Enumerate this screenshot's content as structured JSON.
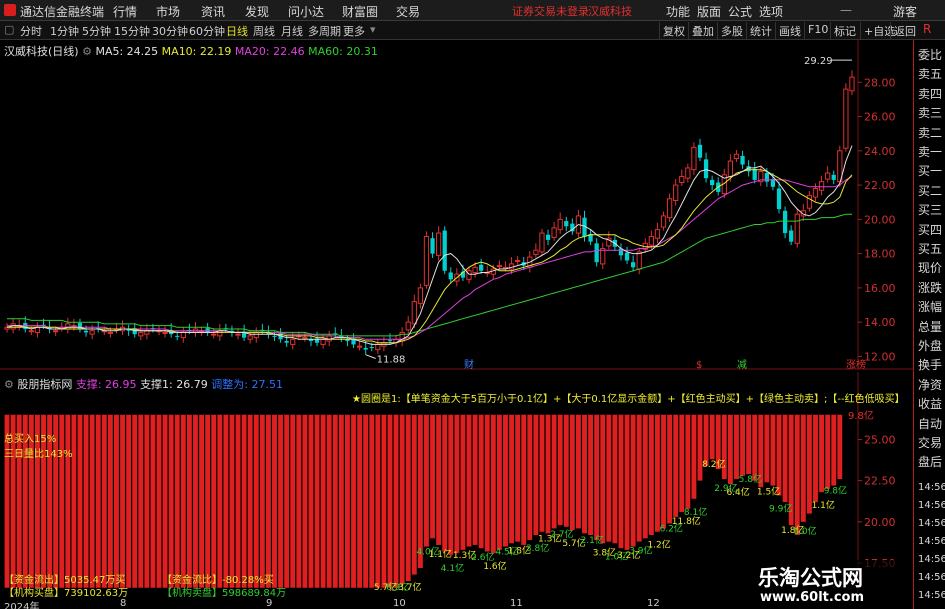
{
  "app": {
    "title": "通达信金融终端",
    "menu": [
      "行情",
      "市场",
      "资讯",
      "发现",
      "问小达",
      "财富圈",
      "交易"
    ],
    "notice": "证券交易未登录",
    "stock_title": "汉威科技",
    "right_menu": [
      "功能",
      "版面",
      "公式",
      "选项"
    ],
    "user": "游客"
  },
  "toolbar": {
    "periods": [
      "分时",
      "1分钟",
      "5分钟",
      "15分钟",
      "30分钟",
      "60分钟",
      "日线",
      "周线",
      "月线",
      "多周期",
      "更多"
    ],
    "selected_period": "日线",
    "buttons": [
      "复权",
      "叠加",
      "多股",
      "统计",
      "画线",
      "F10",
      "标记",
      "+自选",
      "返回"
    ]
  },
  "side_panel": {
    "corner": "R",
    "items": [
      "委比",
      "卖五",
      "卖四",
      "卖三",
      "卖二",
      "卖一",
      "买一",
      "买二",
      "买三",
      "买四",
      "买五",
      "现价",
      "涨跌",
      "涨幅",
      "总量",
      "外盘",
      "换手",
      "净资",
      "收益",
      "自动",
      "交易",
      "盘后"
    ],
    "time_labels": [
      "14:56",
      "14:56",
      "14:56",
      "14:56",
      "14:56",
      "14:56",
      "14:56"
    ]
  },
  "price_chart": {
    "name_label": "汉威科技(日线)",
    "ma": [
      {
        "label": "MA5: 24.25",
        "color": "#e0e0e0"
      },
      {
        "label": "MA10: 22.19",
        "color": "#e8e830"
      },
      {
        "label": "MA20: 22.46",
        "color": "#e040e0"
      },
      {
        "label": "MA60: 20.31",
        "color": "#30d030"
      }
    ],
    "high_label": "29.29",
    "low_label": "11.88",
    "event_marks": [
      {
        "text": "财",
        "color": "#3a7aff"
      },
      {
        "text": "$",
        "color": "#e03030"
      },
      {
        "text": "减",
        "color": "#30d030"
      },
      {
        "text": "涨榜",
        "color": "#e03030"
      }
    ]
  },
  "indicator": {
    "name": "股朋指标网",
    "support_a": "支撑: 26.95",
    "support_b": "支撑1: 26.79",
    "support_c": "调整为: 27.51",
    "legend": "★圆圈是1:【单笔资金大于5百万小于0.1亿】+【大于0.1亿显示金额】+【红色主动买】+【绿色主动卖】;【--红色低吸买】",
    "total_buy": "总买入15%",
    "ratio_3day": "三日量比143%",
    "fund_flow": "【资金流出】5035.47万买",
    "fund_ratio": "【资金流比】-80.28%买",
    "inst_buy": "【机构买盘】739102.63万",
    "inst_sell": "【机构卖盘】598689.84万",
    "top_value": "9.8亿",
    "small_labels": [
      "5.7亿",
      "6.9亿",
      "3.7亿",
      "4.0亿",
      "1.1亿",
      "4.1亿",
      "1.3亿",
      "2.6亿",
      "1.6亿",
      "4.5亿",
      "1.8亿",
      "3.8亿",
      "1.3亿",
      "2.7亿",
      "5.7亿",
      "2.1亿",
      "3.8亿",
      "1.0亿",
      "3.2亿",
      "3.9亿",
      "1.2亿",
      "6.2亿",
      "11.8亿",
      "8.1亿",
      "8.2亿",
      "2.9亿",
      "6.4亿",
      "5.8亿",
      "1.5亿",
      "9.9亿",
      "1.8亿",
      "6.0亿",
      "1.1亿",
      "9.8亿"
    ]
  },
  "axes": {
    "price_ticks": [
      "28.00",
      "26.00",
      "24.00",
      "22.00",
      "20.00",
      "18.00",
      "16.00",
      "14.00",
      "12.00"
    ],
    "ind_ticks": [
      "25.00",
      "22.50",
      "20.00",
      "17.50"
    ],
    "x_ticks": [
      "2024年",
      "8",
      "9",
      "10",
      "11",
      "12"
    ]
  },
  "watermark": {
    "title": "乐淘公式网",
    "url": "www.60lt.com"
  },
  "colors": {
    "up": "#e03030",
    "down": "#00d0d0",
    "ma5": "#e0e0e0",
    "ma10": "#e8e830",
    "ma20": "#e040e0",
    "ma60": "#30d030",
    "indicator_bar": "#e02020"
  },
  "chart_data": {
    "type": "candlestick",
    "y_range": [
      11.5,
      30
    ],
    "closes": [
      13.7,
      13.9,
      13.8,
      13.6,
      13.5,
      13.7,
      13.8,
      13.6,
      13.5,
      13.7,
      13.9,
      13.8,
      13.6,
      13.4,
      13.5,
      13.6,
      13.5,
      13.4,
      13.6,
      13.7,
      13.5,
      13.3,
      13.4,
      13.5,
      13.6,
      13.5,
      13.4,
      13.3,
      13.2,
      13.4,
      13.5,
      13.6,
      13.5,
      13.4,
      13.3,
      13.5,
      13.6,
      13.4,
      13.3,
      13.1,
      13.2,
      13.4,
      13.5,
      13.3,
      13.2,
      13.0,
      12.8,
      13.0,
      13.2,
      13.1,
      12.9,
      12.8,
      13.0,
      13.2,
      13.3,
      13.1,
      12.9,
      12.7,
      12.6,
      12.4,
      12.5,
      12.7,
      12.8,
      12.9,
      13.0,
      13.4,
      14.0,
      15.2,
      16.0,
      19.0,
      18.0,
      19.2,
      17.0,
      16.5,
      16.8,
      16.6,
      17.0,
      17.2,
      17.0,
      16.9,
      17.1,
      17.3,
      17.2,
      17.4,
      17.6,
      17.3,
      17.8,
      18.2,
      19.2,
      18.8,
      19.5,
      20.0,
      19.6,
      19.3,
      20.2,
      19.0,
      18.7,
      17.5,
      18.3,
      18.9,
      18.4,
      17.9,
      17.6,
      17.2,
      18.1,
      18.6,
      19.0,
      19.4,
      20.2,
      21.2,
      22.0,
      22.5,
      23.0,
      24.2,
      23.6,
      22.4,
      22.0,
      21.6,
      22.6,
      23.4,
      23.8,
      23.2,
      22.8,
      22.3,
      22.8,
      22.2,
      21.9,
      20.6,
      19.2,
      18.7,
      20.3,
      20.5,
      21.4,
      21.8,
      22.2,
      22.7,
      22.3,
      24.0,
      27.6,
      28.3
    ],
    "ma5": [
      13.7,
      13.8,
      13.8,
      13.7,
      13.6,
      13.7,
      13.7,
      13.6,
      13.6,
      13.6,
      13.7,
      13.7,
      13.7,
      13.6,
      13.6,
      13.6,
      13.5,
      13.5,
      13.5,
      13.6,
      13.6,
      13.5,
      13.5,
      13.5,
      13.5,
      13.5,
      13.5,
      13.4,
      13.4,
      13.4,
      13.4,
      13.4,
      13.4,
      13.4,
      13.4,
      13.5,
      13.5,
      13.4,
      13.4,
      13.4,
      13.3,
      13.3,
      13.3,
      13.3,
      13.3,
      13.2,
      13.1,
      13.1,
      13.0,
      13.0,
      13.0,
      13.0,
      13.0,
      13.0,
      13.1,
      13.1,
      13.1,
      13.0,
      12.9,
      12.8,
      12.7,
      12.7,
      12.7,
      12.7,
      12.8,
      13.0,
      13.2,
      13.8,
      14.5,
      15.5,
      16.5,
      17.5,
      17.9,
      18.0,
      17.7,
      17.2,
      16.8,
      16.8,
      16.9,
      16.9,
      17.0,
      17.1,
      17.1,
      17.2,
      17.3,
      17.4,
      17.5,
      17.7,
      17.9,
      18.1,
      18.5,
      18.9,
      19.2,
      19.4,
      19.7,
      19.6,
      19.4,
      19.1,
      18.9,
      18.8,
      18.6,
      18.3,
      18.1,
      18.0,
      18.0,
      18.1,
      18.2,
      18.5,
      18.9,
      19.6,
      20.2,
      20.9,
      21.6,
      22.3,
      22.8,
      22.9,
      22.8,
      22.6,
      22.4,
      22.5,
      22.6,
      22.8,
      23.0,
      23.0,
      23.1,
      22.8,
      22.5,
      22.1,
      21.6,
      21.0,
      20.6,
      20.3,
      20.2,
      20.4,
      20.8,
      21.3,
      21.6,
      22.1,
      23.4,
      24.3
    ],
    "ma10": [
      13.7,
      13.7,
      13.7,
      13.7,
      13.7,
      13.7,
      13.7,
      13.7,
      13.7,
      13.6,
      13.6,
      13.6,
      13.6,
      13.6,
      13.6,
      13.6,
      13.6,
      13.6,
      13.6,
      13.6,
      13.6,
      13.6,
      13.5,
      13.5,
      13.5,
      13.5,
      13.5,
      13.5,
      13.4,
      13.4,
      13.4,
      13.4,
      13.4,
      13.4,
      13.4,
      13.4,
      13.4,
      13.4,
      13.4,
      13.4,
      13.4,
      13.4,
      13.4,
      13.4,
      13.3,
      13.3,
      13.2,
      13.2,
      13.2,
      13.2,
      13.2,
      13.1,
      13.1,
      13.0,
      13.0,
      13.0,
      13.0,
      13.0,
      13.0,
      12.9,
      12.9,
      12.8,
      12.8,
      12.8,
      12.8,
      12.9,
      13.0,
      13.2,
      13.6,
      14.1,
      14.7,
      15.3,
      15.9,
      16.3,
      16.6,
      16.9,
      17.2,
      17.4,
      17.5,
      17.4,
      17.2,
      17.0,
      17.0,
      17.0,
      17.1,
      17.2,
      17.3,
      17.4,
      17.5,
      17.7,
      17.9,
      18.2,
      18.4,
      18.7,
      18.9,
      19.0,
      19.1,
      19.1,
      19.1,
      19.1,
      19.1,
      18.9,
      18.8,
      18.6,
      18.5,
      18.4,
      18.4,
      18.4,
      18.5,
      18.8,
      19.1,
      19.5,
      20.0,
      20.5,
      20.9,
      21.3,
      21.6,
      21.9,
      22.1,
      22.4,
      22.7,
      22.8,
      22.9,
      22.9,
      22.9,
      22.8,
      22.6,
      22.4,
      22.2,
      21.9,
      21.6,
      21.4,
      21.2,
      21.0,
      20.9,
      20.9,
      21.0,
      21.3,
      22.2,
      22.6
    ],
    "ma20": [
      13.8,
      13.8,
      13.8,
      13.8,
      13.8,
      13.8,
      13.8,
      13.7,
      13.7,
      13.7,
      13.7,
      13.7,
      13.7,
      13.7,
      13.7,
      13.7,
      13.7,
      13.6,
      13.6,
      13.6,
      13.6,
      13.6,
      13.6,
      13.6,
      13.6,
      13.6,
      13.6,
      13.5,
      13.5,
      13.5,
      13.5,
      13.5,
      13.5,
      13.5,
      13.5,
      13.5,
      13.5,
      13.4,
      13.4,
      13.4,
      13.4,
      13.4,
      13.4,
      13.4,
      13.4,
      13.4,
      13.3,
      13.3,
      13.3,
      13.3,
      13.3,
      13.2,
      13.2,
      13.2,
      13.2,
      13.1,
      13.1,
      13.1,
      13.1,
      13.0,
      13.0,
      13.0,
      13.0,
      13.0,
      13.0,
      13.0,
      13.1,
      13.2,
      13.4,
      13.6,
      13.9,
      14.2,
      14.5,
      14.8,
      15.1,
      15.4,
      15.6,
      15.9,
      16.1,
      16.3,
      16.5,
      16.6,
      16.8,
      16.9,
      17.0,
      17.1,
      17.2,
      17.3,
      17.4,
      17.5,
      17.6,
      17.7,
      17.8,
      17.9,
      18.0,
      18.1,
      18.1,
      18.2,
      18.2,
      18.2,
      18.2,
      18.2,
      18.2,
      18.2,
      18.3,
      18.3,
      18.4,
      18.5,
      18.7,
      18.9,
      19.1,
      19.4,
      19.7,
      20.0,
      20.3,
      20.6,
      20.9,
      21.2,
      21.4,
      21.6,
      21.8,
      22.0,
      22.1,
      22.2,
      22.3,
      22.3,
      22.3,
      22.3,
      22.3,
      22.2,
      22.1,
      22.0,
      21.9,
      21.9,
      21.9,
      21.9,
      21.9,
      22.0,
      22.3,
      22.5
    ],
    "ma60": [
      14.2,
      14.2,
      14.2,
      14.2,
      14.1,
      14.1,
      14.1,
      14.1,
      14.1,
      14.1,
      14.0,
      14.0,
      14.0,
      14.0,
      14.0,
      14.0,
      13.9,
      13.9,
      13.9,
      13.9,
      13.9,
      13.9,
      13.8,
      13.8,
      13.8,
      13.8,
      13.8,
      13.8,
      13.7,
      13.7,
      13.7,
      13.7,
      13.7,
      13.7,
      13.6,
      13.6,
      13.6,
      13.6,
      13.6,
      13.6,
      13.5,
      13.5,
      13.5,
      13.5,
      13.5,
      13.4,
      13.4,
      13.4,
      13.4,
      13.4,
      13.3,
      13.3,
      13.3,
      13.3,
      13.3,
      13.2,
      13.2,
      13.2,
      13.2,
      13.2,
      13.2,
      13.2,
      13.2,
      13.2,
      13.2,
      13.3,
      13.3,
      13.4,
      13.5,
      13.6,
      13.7,
      13.8,
      13.9,
      14.0,
      14.1,
      14.2,
      14.3,
      14.4,
      14.5,
      14.6,
      14.7,
      14.8,
      14.9,
      15.0,
      15.1,
      15.2,
      15.3,
      15.4,
      15.5,
      15.6,
      15.7,
      15.8,
      15.9,
      16.0,
      16.1,
      16.2,
      16.3,
      16.4,
      16.5,
      16.6,
      16.7,
      16.8,
      16.9,
      17.0,
      17.1,
      17.2,
      17.3,
      17.4,
      17.5,
      17.7,
      17.9,
      18.1,
      18.3,
      18.5,
      18.7,
      18.9,
      19.0,
      19.1,
      19.2,
      19.3,
      19.4,
      19.5,
      19.6,
      19.7,
      19.7,
      19.8,
      19.8,
      19.9,
      19.9,
      19.9,
      19.9,
      20.0,
      20.0,
      20.0,
      20.1,
      20.1,
      20.1,
      20.2,
      20.3,
      20.3
    ],
    "indicator_y_range": [
      15.5,
      28.0
    ],
    "indicator_values": [
      26.5,
      26.5,
      26.5,
      26.5,
      26.5,
      26.5,
      26.5,
      26.5,
      26.5,
      26.5,
      26.5,
      26.5,
      26.5,
      26.5,
      26.5,
      26.5,
      26.5,
      26.5,
      26.5,
      26.5,
      26.5,
      26.5,
      26.5,
      26.5,
      26.5,
      26.5,
      26.5,
      26.5,
      26.5,
      26.5,
      26.5,
      26.5,
      26.5,
      26.5,
      26.5,
      26.5,
      26.5,
      26.5,
      26.5,
      26.5,
      26.5,
      26.5,
      26.5,
      26.5,
      26.5,
      26.5,
      26.5,
      26.5,
      26.5,
      26.5,
      26.5,
      26.5,
      26.5,
      26.5,
      26.5,
      26.5,
      26.5,
      26.5,
      26.5,
      26.5,
      26.5,
      26.5,
      26.5,
      26.5,
      26.5,
      26.5,
      26.5,
      26.5,
      26.5,
      26.5,
      26.5,
      26.5,
      26.5,
      26.5,
      26.5,
      26.5,
      26.5,
      26.5,
      26.5,
      26.5,
      26.5,
      26.5,
      26.5,
      26.5,
      26.5,
      26.5,
      26.5,
      26.5,
      26.5,
      26.5,
      26.5,
      26.5,
      26.5,
      26.5,
      26.5,
      26.5,
      26.5,
      26.5,
      26.5,
      26.5,
      26.5,
      26.5,
      26.5,
      26.5,
      26.5,
      26.5,
      26.5,
      26.5,
      26.5,
      26.5,
      26.5,
      26.5,
      26.5,
      26.5,
      26.5,
      26.5,
      26.5,
      26.5,
      26.5,
      26.5,
      26.5,
      26.5,
      26.5,
      26.5,
      26.5,
      26.5,
      26.5,
      26.5,
      26.5,
      26.5,
      26.5,
      26.5,
      26.5,
      26.5,
      26.5,
      26.5,
      26.5,
      26.5
    ],
    "indicator_tops": [
      16.0,
      16.0,
      16.0,
      16.0,
      16.0,
      16.0,
      16.0,
      16.0,
      16.0,
      16.0,
      16.0,
      16.0,
      16.0,
      16.0,
      16.0,
      16.0,
      16.0,
      16.0,
      16.0,
      16.0,
      16.0,
      16.0,
      16.0,
      16.0,
      16.0,
      16.0,
      16.0,
      16.0,
      16.0,
      16.0,
      16.0,
      16.0,
      16.0,
      16.0,
      16.0,
      16.0,
      16.0,
      16.0,
      16.0,
      16.0,
      16.0,
      16.0,
      16.0,
      16.0,
      16.0,
      16.0,
      16.0,
      16.0,
      16.0,
      16.0,
      16.0,
      16.0,
      16.0,
      16.0,
      16.0,
      16.0,
      16.0,
      16.0,
      16.0,
      16.0,
      16.0,
      16.0,
      16.0,
      16.0,
      16.0,
      16.2,
      16.4,
      16.8,
      17.2,
      18.5,
      19.0,
      18.6,
      18.2,
      18.0,
      18.1,
      18.3,
      18.5,
      18.6,
      18.4,
      18.2,
      18.1,
      18.3,
      18.5,
      18.7,
      18.8,
      18.6,
      18.9,
      19.2,
      19.4,
      19.3,
      19.6,
      19.8,
      19.7,
      19.5,
      19.6,
      19.3,
      19.2,
      18.9,
      18.7,
      18.8,
      18.7,
      18.4,
      18.3,
      18.5,
      18.8,
      19.0,
      19.2,
      19.4,
      19.6,
      19.9,
      20.3,
      20.6,
      20.8,
      21.4,
      22.5,
      23.4,
      23.8,
      23.2,
      22.6,
      22.3,
      22.6,
      22.8,
      22.9,
      22.5,
      22.1,
      22.4,
      22.2,
      21.6,
      21.2,
      19.8,
      19.2,
      20.0,
      20.5,
      21.2,
      21.8,
      22.0,
      22.2,
      22.6,
      23.4,
      25.4,
      26.0
    ]
  }
}
